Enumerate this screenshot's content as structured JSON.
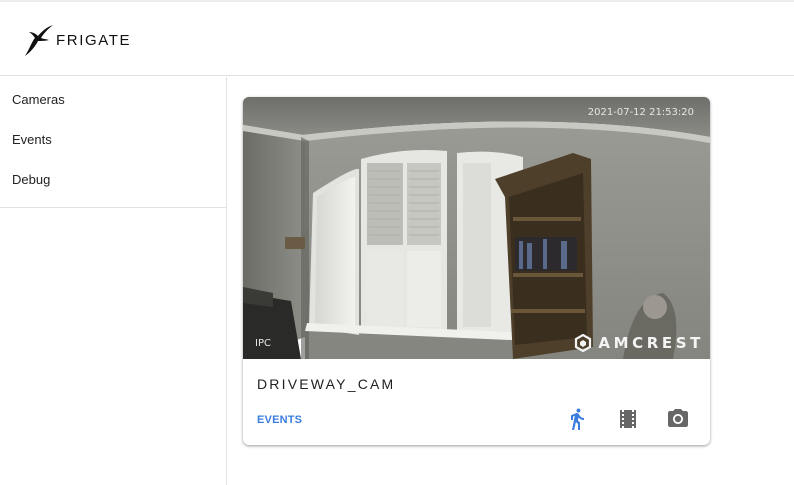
{
  "app": {
    "brand": "FRIGATE"
  },
  "sidebar": {
    "items": [
      {
        "label": "Cameras"
      },
      {
        "label": "Events"
      },
      {
        "label": "Debug"
      }
    ]
  },
  "camera_card": {
    "name": "DRIVEWAY_CAM",
    "events_label": "EVENTS",
    "feed": {
      "timestamp": "2021-07-12 21:53:20",
      "corner_label": "IPC",
      "watermark": "AMCREST"
    },
    "icons": {
      "detect": "walking-person-icon",
      "clips": "film-strip-icon",
      "snapshots": "camera-icon"
    }
  },
  "colors": {
    "accent": "#3b7ddd",
    "icon_gray": "#666666",
    "border": "#e2e2e2"
  }
}
